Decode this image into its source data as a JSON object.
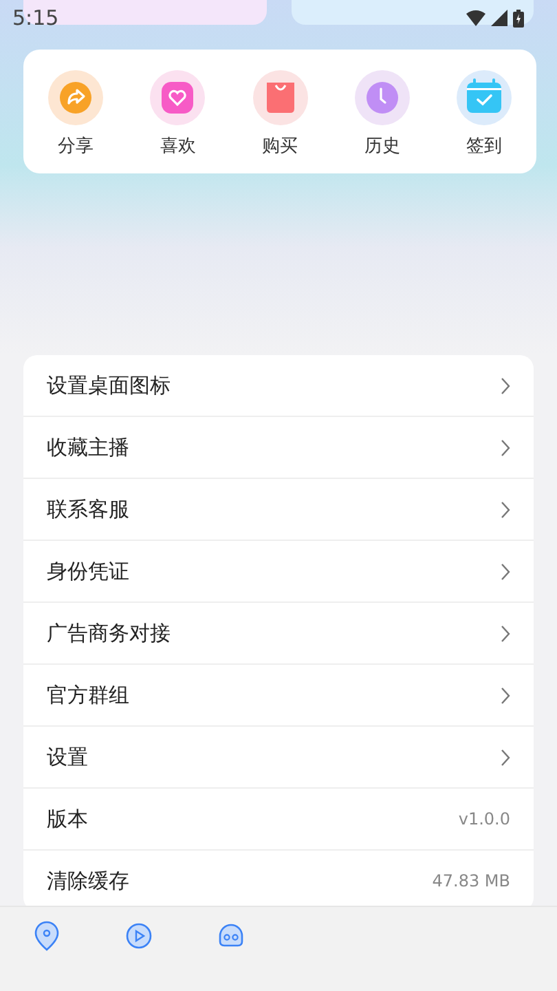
{
  "status_bar": {
    "time": "5:15"
  },
  "quick_actions": [
    {
      "label": "分享",
      "kind": "share"
    },
    {
      "label": "喜欢",
      "kind": "like"
    },
    {
      "label": "购买",
      "kind": "buy"
    },
    {
      "label": "历史",
      "kind": "history"
    },
    {
      "label": "签到",
      "kind": "checkin"
    }
  ],
  "menu": [
    {
      "label": "设置桌面图标",
      "kind": "link"
    },
    {
      "label": "收藏主播",
      "kind": "link"
    },
    {
      "label": "联系客服",
      "kind": "link"
    },
    {
      "label": "身份凭证",
      "kind": "link"
    },
    {
      "label": "广告商务对接",
      "kind": "link"
    },
    {
      "label": "官方群组",
      "kind": "link"
    },
    {
      "label": "设置",
      "kind": "link"
    },
    {
      "label": "版本",
      "kind": "value",
      "value": "v1.0.0"
    },
    {
      "label": "清除缓存",
      "kind": "value",
      "value": "47.83 MB"
    }
  ],
  "bottom_nav": [
    {
      "kind": "pin"
    },
    {
      "kind": "play"
    },
    {
      "kind": "skull"
    }
  ]
}
